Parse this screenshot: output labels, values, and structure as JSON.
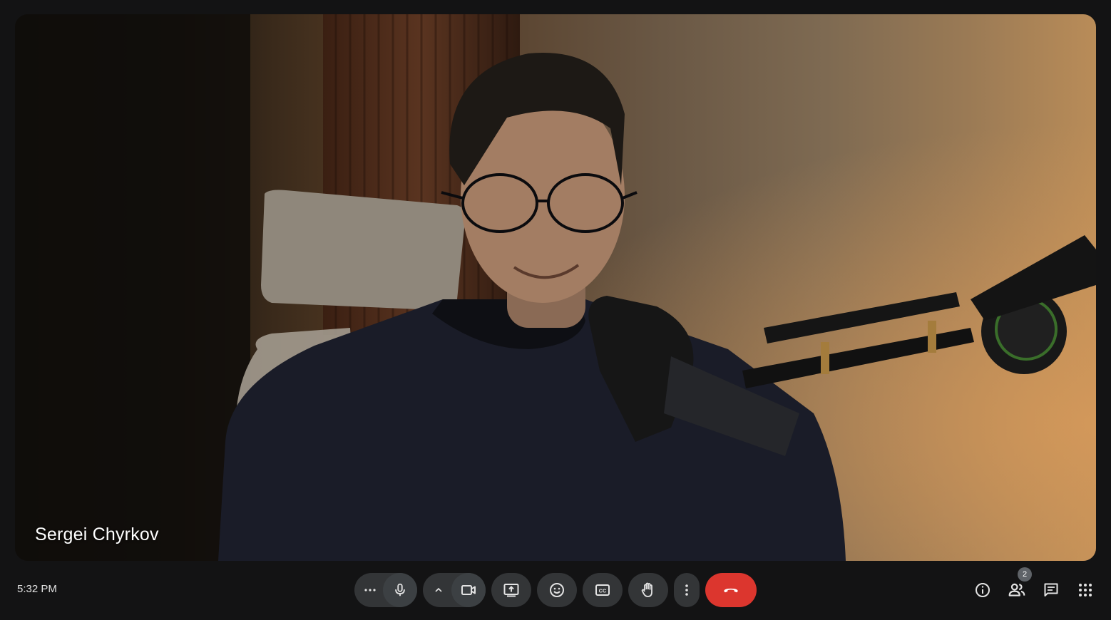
{
  "video": {
    "participant_name": "Sergei Chyrkov"
  },
  "status": {
    "clock": "5:32 PM"
  },
  "controls": {
    "more_options_icon": "more-horizontal-icon",
    "microphone_icon": "microphone-icon",
    "camera_options_icon": "chevron-up-icon",
    "camera_icon": "videocam-icon",
    "present_icon": "present-screen-icon",
    "reactions_icon": "emoji-icon",
    "captions_icon": "closed-captions-icon",
    "raise_hand_icon": "raise-hand-icon",
    "more_actions_icon": "more-vertical-icon",
    "end_call_icon": "call-end-icon",
    "end_call_color": "#dc362e"
  },
  "side_panel": {
    "info_icon": "info-icon",
    "people_icon": "people-icon",
    "people_count": "2",
    "chat_icon": "chat-icon",
    "activities_icon": "apps-grid-icon"
  },
  "colors": {
    "background": "#131314",
    "button": "#333537",
    "text": "#e3e3e3"
  }
}
